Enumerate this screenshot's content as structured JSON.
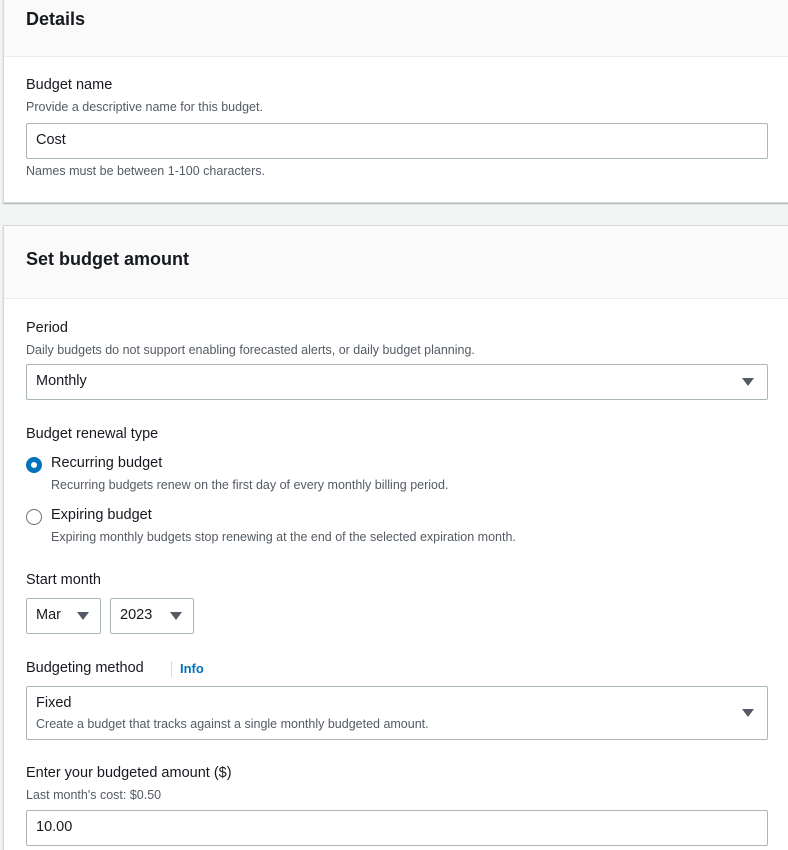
{
  "details": {
    "title": "Details",
    "budget_name_label": "Budget name",
    "budget_name_desc": "Provide a descriptive name for this budget.",
    "budget_name_value": "Cost",
    "budget_name_hint": "Names must be between 1-100 characters."
  },
  "set_budget": {
    "title": "Set budget amount",
    "period_label": "Period",
    "period_desc": "Daily budgets do not support enabling forecasted alerts, or daily budget planning.",
    "period_value": "Monthly",
    "renewal_label": "Budget renewal type",
    "renewal_options": [
      {
        "label": "Recurring budget",
        "desc": "Recurring budgets renew on the first day of every monthly billing period.",
        "selected": true
      },
      {
        "label": "Expiring budget",
        "desc": "Expiring monthly budgets stop renewing at the end of the selected expiration month.",
        "selected": false
      }
    ],
    "start_month_label": "Start month",
    "start_month_value": "Mar",
    "start_year_value": "2023",
    "method_label": "Budgeting method",
    "method_info": "Info",
    "method_value": "Fixed",
    "method_value_desc": "Create a budget that tracks against a single monthly budgeted amount.",
    "amount_label": "Enter your budgeted amount ($)",
    "amount_desc": "Last month's cost: $0.50",
    "amount_value": "10.00"
  },
  "colors": {
    "accent": "#0073bb",
    "text": "#16191f",
    "muted": "#545b64",
    "border": "#aab7b8",
    "page_bg": "#f2f3f3"
  },
  "icons": {
    "dropdown": "caret-down-icon"
  }
}
